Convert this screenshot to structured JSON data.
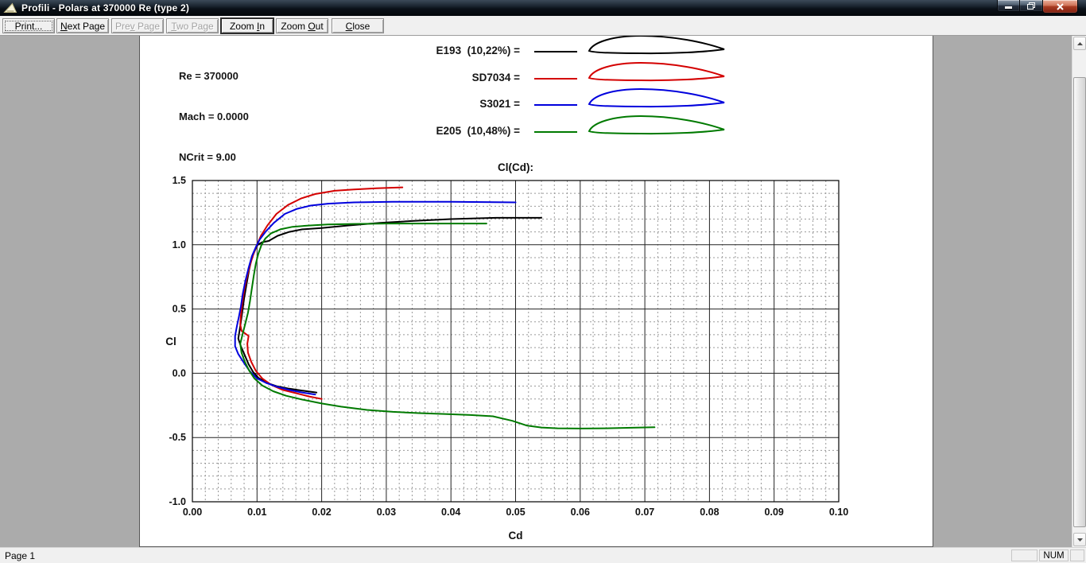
{
  "window": {
    "title": "Profili - Polars at 370000 Re (type 2)",
    "controls": {
      "minimize": "minimize",
      "restore": "restore",
      "close": "close"
    }
  },
  "toolbar": {
    "buttons": [
      {
        "label": "Print...",
        "mnemonic": -1,
        "enabled": true,
        "style": "default"
      },
      {
        "label": "Next Page",
        "mnemonic": 0,
        "enabled": true,
        "style": ""
      },
      {
        "label": "Prev Page",
        "mnemonic": 3,
        "enabled": false,
        "style": ""
      },
      {
        "label": "Two Page",
        "mnemonic": 0,
        "enabled": false,
        "style": ""
      },
      {
        "label": "Zoom In",
        "mnemonic": 5,
        "enabled": true,
        "style": "strong"
      },
      {
        "label": "Zoom Out",
        "mnemonic": 5,
        "enabled": true,
        "style": ""
      },
      {
        "label": "Close",
        "mnemonic": 0,
        "enabled": true,
        "style": ""
      }
    ]
  },
  "page": {
    "conditions": {
      "re": "Re = 370000",
      "mach": "Mach = 0.0000",
      "ncrit": "NCrit = 9.00"
    },
    "legend": [
      {
        "label": "E193  (10,22%) =",
        "color": "#000000"
      },
      {
        "label": "SD7034 =",
        "color": "#d40000"
      },
      {
        "label": "S3021 =",
        "color": "#0000dd"
      },
      {
        "label": "E205  (10,48%) =",
        "color": "#007a00"
      }
    ]
  },
  "chart_data": {
    "type": "line",
    "title": "Cl(Cd):",
    "xlabel": "Cd",
    "ylabel": "Cl",
    "xlim": [
      0.0,
      0.1
    ],
    "ylim": [
      -1.0,
      1.5
    ],
    "x_major": 0.01,
    "x_minor": 0.002,
    "y_major": 0.5,
    "y_minor": 0.1,
    "x_ticks": [
      "0.00",
      "0.01",
      "0.02",
      "0.03",
      "0.04",
      "0.05",
      "0.06",
      "0.07",
      "0.08",
      "0.09",
      "0.10"
    ],
    "y_ticks": [
      "1.5",
      "1.0",
      "0.5",
      "0.0",
      "-0.5",
      "-1.0"
    ],
    "grid": true,
    "legend_position": "top",
    "series": [
      {
        "name": "E193 (10,22%)",
        "color": "#000000",
        "points": [
          [
            0.0192,
            -0.15
          ],
          [
            0.017,
            -0.135
          ],
          [
            0.015,
            -0.12
          ],
          [
            0.013,
            -0.1
          ],
          [
            0.0115,
            -0.075
          ],
          [
            0.0102,
            -0.035
          ],
          [
            0.0094,
            0.01
          ],
          [
            0.0087,
            0.07
          ],
          [
            0.0081,
            0.14
          ],
          [
            0.0075,
            0.21
          ],
          [
            0.0071,
            0.27
          ],
          [
            0.0073,
            0.33
          ],
          [
            0.0075,
            0.4
          ],
          [
            0.0077,
            0.47
          ],
          [
            0.008,
            0.58
          ],
          [
            0.0084,
            0.7
          ],
          [
            0.0088,
            0.81
          ],
          [
            0.0092,
            0.9
          ],
          [
            0.0097,
            0.96
          ],
          [
            0.0101,
            1.0
          ],
          [
            0.0108,
            1.02
          ],
          [
            0.0118,
            1.03
          ],
          [
            0.0132,
            1.07
          ],
          [
            0.015,
            1.1
          ],
          [
            0.017,
            1.12
          ],
          [
            0.02,
            1.13
          ],
          [
            0.024,
            1.15
          ],
          [
            0.029,
            1.17
          ],
          [
            0.034,
            1.185
          ],
          [
            0.04,
            1.2
          ],
          [
            0.047,
            1.21
          ],
          [
            0.054,
            1.21
          ]
        ]
      },
      {
        "name": "SD7034",
        "color": "#d40000",
        "points": [
          [
            0.02,
            -0.2
          ],
          [
            0.018,
            -0.18
          ],
          [
            0.016,
            -0.155
          ],
          [
            0.014,
            -0.13
          ],
          [
            0.0122,
            -0.09
          ],
          [
            0.0108,
            -0.04
          ],
          [
            0.0098,
            0.02
          ],
          [
            0.0091,
            0.09
          ],
          [
            0.0086,
            0.16
          ],
          [
            0.0085,
            0.23
          ],
          [
            0.0087,
            0.29
          ],
          [
            0.0076,
            0.33
          ],
          [
            0.0074,
            0.38
          ],
          [
            0.0075,
            0.45
          ],
          [
            0.0077,
            0.54
          ],
          [
            0.008,
            0.64
          ],
          [
            0.0084,
            0.74
          ],
          [
            0.0089,
            0.84
          ],
          [
            0.0094,
            0.92
          ],
          [
            0.0099,
            0.99
          ],
          [
            0.0106,
            1.07
          ],
          [
            0.0116,
            1.15
          ],
          [
            0.013,
            1.24
          ],
          [
            0.0148,
            1.31
          ],
          [
            0.0168,
            1.36
          ],
          [
            0.019,
            1.395
          ],
          [
            0.022,
            1.42
          ],
          [
            0.025,
            1.43
          ],
          [
            0.0285,
            1.44
          ],
          [
            0.0325,
            1.447
          ]
        ]
      },
      {
        "name": "S3021",
        "color": "#0000dd",
        "points": [
          [
            0.019,
            -0.165
          ],
          [
            0.017,
            -0.15
          ],
          [
            0.015,
            -0.13
          ],
          [
            0.0131,
            -0.105
          ],
          [
            0.0114,
            -0.075
          ],
          [
            0.01,
            -0.04
          ],
          [
            0.0089,
            0.015
          ],
          [
            0.008,
            0.08
          ],
          [
            0.0071,
            0.15
          ],
          [
            0.0066,
            0.21
          ],
          [
            0.0066,
            0.29
          ],
          [
            0.0069,
            0.37
          ],
          [
            0.0072,
            0.44
          ],
          [
            0.0075,
            0.52
          ],
          [
            0.0078,
            0.62
          ],
          [
            0.0082,
            0.72
          ],
          [
            0.0087,
            0.82
          ],
          [
            0.0092,
            0.91
          ],
          [
            0.0098,
            0.98
          ],
          [
            0.0104,
            1.04
          ],
          [
            0.0113,
            1.1
          ],
          [
            0.0126,
            1.17
          ],
          [
            0.0143,
            1.24
          ],
          [
            0.0162,
            1.28
          ],
          [
            0.0183,
            1.305
          ],
          [
            0.021,
            1.32
          ],
          [
            0.025,
            1.33
          ],
          [
            0.031,
            1.335
          ],
          [
            0.04,
            1.335
          ],
          [
            0.05,
            1.33
          ]
        ]
      },
      {
        "name": "E205 (10,48%)",
        "color": "#007a00",
        "points": [
          [
            0.0715,
            -0.42
          ],
          [
            0.068,
            -0.424
          ],
          [
            0.064,
            -0.428
          ],
          [
            0.06,
            -0.43
          ],
          [
            0.0565,
            -0.428
          ],
          [
            0.054,
            -0.422
          ],
          [
            0.0518,
            -0.408
          ],
          [
            0.0495,
            -0.37
          ],
          [
            0.0465,
            -0.335
          ],
          [
            0.043,
            -0.325
          ],
          [
            0.039,
            -0.317
          ],
          [
            0.035,
            -0.31
          ],
          [
            0.031,
            -0.3
          ],
          [
            0.027,
            -0.285
          ],
          [
            0.023,
            -0.26
          ],
          [
            0.02,
            -0.235
          ],
          [
            0.017,
            -0.205
          ],
          [
            0.0145,
            -0.175
          ],
          [
            0.0125,
            -0.14
          ],
          [
            0.0108,
            -0.095
          ],
          [
            0.0096,
            -0.04
          ],
          [
            0.0088,
            0.02
          ],
          [
            0.0081,
            0.09
          ],
          [
            0.0076,
            0.16
          ],
          [
            0.0074,
            0.23
          ],
          [
            0.0078,
            0.31
          ],
          [
            0.0082,
            0.39
          ],
          [
            0.0086,
            0.47
          ],
          [
            0.0089,
            0.56
          ],
          [
            0.0092,
            0.66
          ],
          [
            0.0095,
            0.76
          ],
          [
            0.0098,
            0.85
          ],
          [
            0.0102,
            0.93
          ],
          [
            0.0107,
            1.0
          ],
          [
            0.0113,
            1.05
          ],
          [
            0.0122,
            1.09
          ],
          [
            0.0136,
            1.12
          ],
          [
            0.0155,
            1.14
          ],
          [
            0.018,
            1.15
          ],
          [
            0.021,
            1.158
          ],
          [
            0.025,
            1.162
          ],
          [
            0.03,
            1.165
          ],
          [
            0.0355,
            1.165
          ],
          [
            0.041,
            1.165
          ],
          [
            0.0455,
            1.165
          ]
        ]
      }
    ]
  },
  "status_bar": {
    "left": "Page 1",
    "num": "NUM"
  }
}
